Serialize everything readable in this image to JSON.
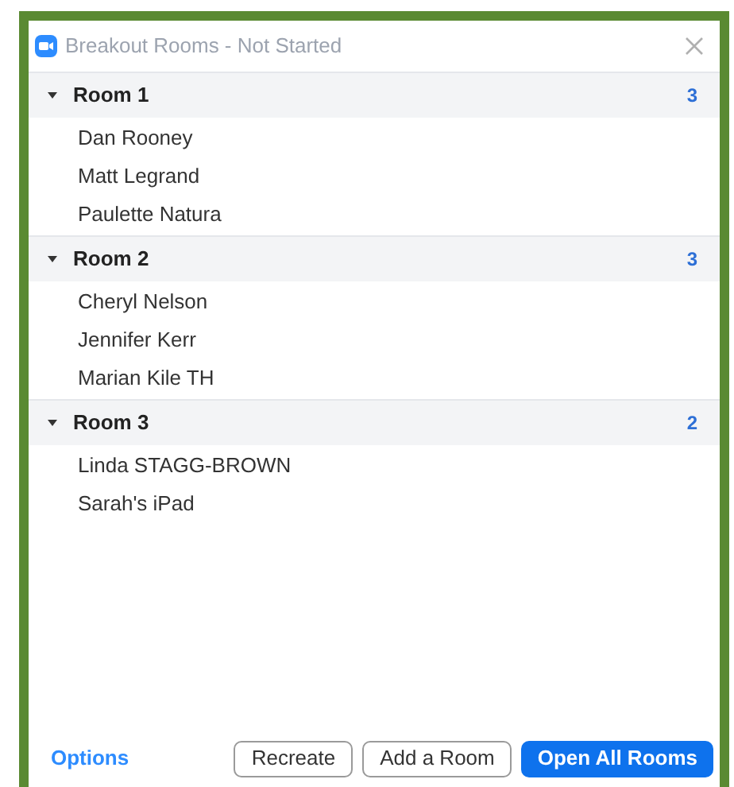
{
  "window": {
    "title": "Breakout Rooms - Not Started"
  },
  "rooms": [
    {
      "name": "Room 1",
      "count": "3",
      "expanded": true,
      "members": [
        "Dan Rooney",
        "Matt Legrand",
        "Paulette Natura"
      ]
    },
    {
      "name": "Room 2",
      "count": "3",
      "expanded": true,
      "members": [
        "Cheryl Nelson",
        "Jennifer Kerr",
        "Marian Kile TH"
      ]
    },
    {
      "name": "Room 3",
      "count": "2",
      "expanded": true,
      "members": [
        "Linda STAGG-BROWN",
        "Sarah's iPad"
      ]
    }
  ],
  "footer": {
    "link": "Options",
    "buttons": [
      {
        "label": "Recreate",
        "kind": "secondary"
      },
      {
        "label": "Add a Room",
        "kind": "secondary"
      },
      {
        "label": "Open All Rooms",
        "kind": "primary"
      }
    ]
  }
}
